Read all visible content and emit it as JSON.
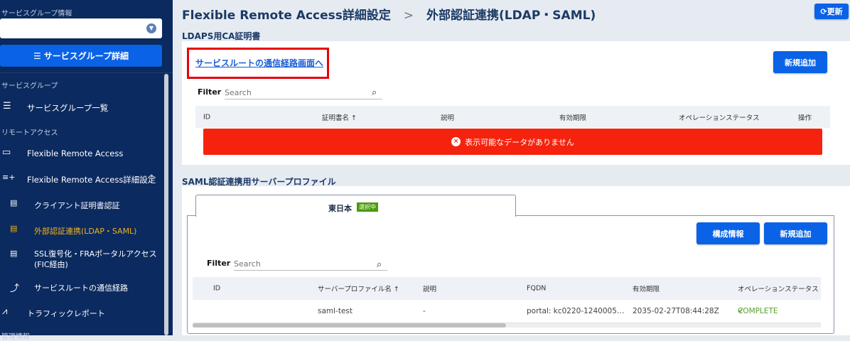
{
  "sidebar": {
    "service_group_info_label": "サービスグループ情報",
    "select_value": "",
    "detail_button": "サービスグループ詳細",
    "section_service_group": "サービスグループ",
    "section_remote_access": "リモートアクセス",
    "section_management": "管理情報",
    "items": [
      {
        "label": "サービスグループ一覧",
        "icon": "list-icon"
      },
      {
        "label": "Flexible Remote Access",
        "icon": "laptop-icon"
      },
      {
        "label": "Flexible Remote Access詳細設定",
        "icon": "playlist-add-icon"
      },
      {
        "label": "クライアント証明書認証",
        "icon": "certificate-icon"
      },
      {
        "label": "外部認証連携(LDAP・SAML)",
        "icon": "certificate-icon",
        "active": true
      },
      {
        "label": "SSL復号化・FRAポータルアクセス",
        "label2": "(FIC経由)",
        "icon": "certificate-icon"
      },
      {
        "label": "サービスルートの通信経路",
        "icon": "route-icon"
      },
      {
        "label": "トラフィックレポート",
        "icon": "chart-icon"
      }
    ]
  },
  "header": {
    "breadcrumb_parent": "Flexible Remote Access詳細設定",
    "separator": ">",
    "breadcrumb_current": "外部認証連携(LDAP・SAML)",
    "refresh_button": "更新"
  },
  "ldaps": {
    "section_title": "LDAPS用CA証明書",
    "link": "サービスルートの通信経路画面へ",
    "add_button": "新規追加",
    "filter_label": "Filter",
    "search_placeholder": "Search",
    "columns": [
      "ID",
      "証明書名 ↑",
      "説明",
      "有効期限",
      "オペレーションステータス",
      "操作"
    ],
    "empty_message": "表示可能なデータがありません"
  },
  "saml": {
    "section_title": "SAML認証連携用サーバープロファイル",
    "tab_label": "東日本",
    "tab_badge": "選択中",
    "config_button": "構成情報",
    "add_button": "新規追加",
    "filter_label": "Filter",
    "search_placeholder": "Search",
    "columns": [
      "ID",
      "サーバープロファイル名 ↑",
      "説明",
      "FQDN",
      "有効期限",
      "オペレーションステータス"
    ],
    "rows": [
      {
        "id": "",
        "name": "saml-test",
        "description": "-",
        "fqdn": "portal: kc0220-1240005…",
        "expiry": "2035-02-27T08:44:28Z",
        "status": "COMPLETE"
      }
    ]
  },
  "colors": {
    "sidebar": "#0b2a5f",
    "primary": "#0a62e6",
    "error": "#f5230e",
    "active": "#f2b21b",
    "success": "#5aa02c"
  }
}
